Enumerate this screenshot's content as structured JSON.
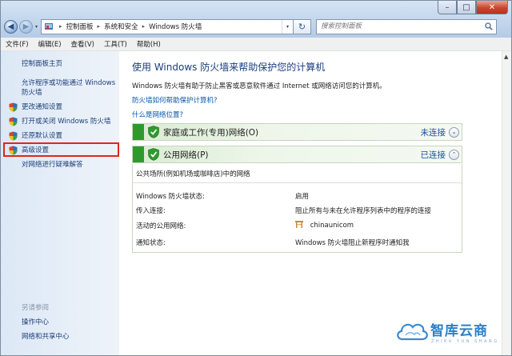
{
  "window": {
    "minimize_glyph": "–",
    "maximize_glyph": "□",
    "close_glyph": "✕"
  },
  "nav": {
    "back_glyph": "◀",
    "forward_glyph": "▶",
    "history_glyph": "▾",
    "breadcrumb": [
      "控制面板",
      "系统和安全",
      "Windows 防火墙"
    ],
    "breadcrumb_sep": "▸",
    "refresh_glyph": "↻",
    "search_placeholder": "搜索控制面板"
  },
  "menu": [
    "文件(F)",
    "编辑(E)",
    "查看(V)",
    "工具(T)",
    "帮助(H)"
  ],
  "sidebar": {
    "home": "控制面板主页",
    "items": [
      {
        "label": "允许程序或功能通过 Windows 防火墙",
        "shield": false
      },
      {
        "label": "更改通知设置",
        "shield": true
      },
      {
        "label": "打开或关闭 Windows 防火墙",
        "shield": true
      },
      {
        "label": "还原默认设置",
        "shield": true
      },
      {
        "label": "高级设置",
        "shield": true,
        "highlighted": true
      },
      {
        "label": "对网络进行疑难解答",
        "shield": false
      }
    ],
    "see_also": "另请参阅",
    "links": [
      "操作中心",
      "网络和共享中心"
    ]
  },
  "main": {
    "title": "使用 Windows 防火墙来帮助保护您的计算机",
    "description": "Windows 防火墙有助于防止黑客或恶意软件通过 Internet 或网络访问您的计算机。",
    "link1": "防火墙如何帮助保护计算机?",
    "link2": "什么是网络位置?",
    "networks": [
      {
        "name": "家庭或工作(专用)网络(O)",
        "status": "未连接",
        "expanded": false
      },
      {
        "name": "公用网络(P)",
        "status": "已连接",
        "expanded": true
      }
    ],
    "public_detail": {
      "summary": "公共场所(例如机场或咖啡店)中的网络",
      "rows": [
        {
          "key": "Windows 防火墙状态:",
          "value": "启用"
        },
        {
          "key": "传入连接:",
          "value": "阻止所有与未在允许程序列表中的程序的连接"
        },
        {
          "key": "活动的公用网络:",
          "value": "chinaunicom"
        },
        {
          "key": "通知状态:",
          "value": "Windows 防火墙阻止新程序时通知我"
        }
      ]
    }
  },
  "watermark": {
    "title": "智库云商",
    "subtitle": "ZHIKU YUN SHANG"
  },
  "colors": {
    "link": "#1e3f7a",
    "highlight_border": "#e0261a",
    "green": "#2e9a2e"
  }
}
